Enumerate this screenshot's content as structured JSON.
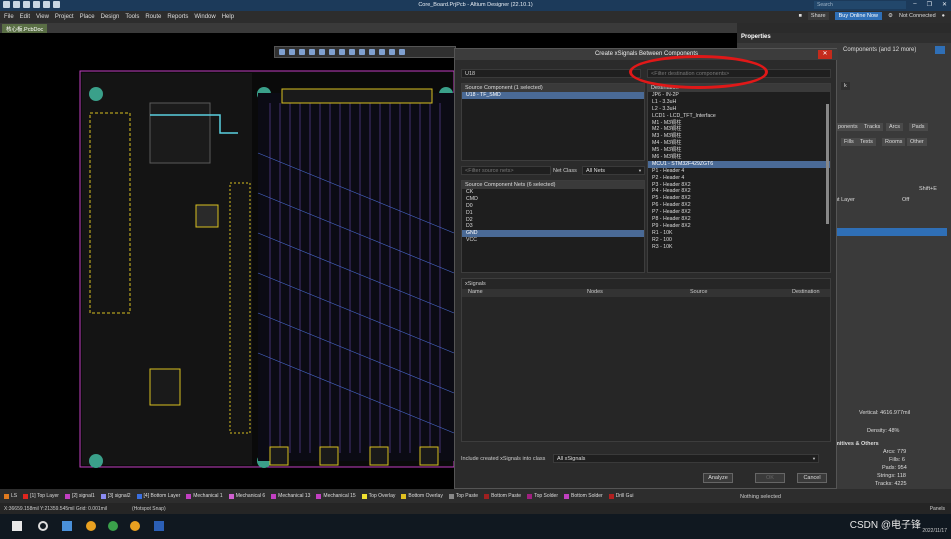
{
  "titlebar": {
    "title": "Core_Board.PrjPcb - Altium Designer (22.10.1)",
    "search": "Search"
  },
  "menu": {
    "items": [
      "File",
      "Edit",
      "View",
      "Project",
      "Place",
      "Design",
      "Tools",
      "Route",
      "Reports",
      "Window",
      "Help"
    ],
    "share": "Share",
    "buy_online": "Buy Online Now",
    "not_connected": "Not Connected"
  },
  "doc_tab": "核心板.PcbDoc",
  "properties": {
    "title": "Properties",
    "components_label": "Components (and 12 more)",
    "tab_partial": "k",
    "filter_tabs": [
      "ponents",
      "Tracks",
      "Arcs",
      "Pads"
    ],
    "filter_tabs2": [
      "Fills",
      "Texts",
      "Rooms",
      "Other"
    ],
    "shift_e": "Shift+E",
    "current_layer_label": "nt Layer",
    "current_layer_value": "Off",
    "vertical": "Vertical:  4616.977mil",
    "density": "Density:  48%",
    "prims_title": "mitives & Others",
    "stats": [
      "Arcs:  779",
      "Fills:  6",
      "Pads:  954",
      "Strings:  118",
      "Tracks:  4225"
    ],
    "panels": "Panels"
  },
  "dialog": {
    "title": "Create xSignals Between Components",
    "source_filter": "U18",
    "dest_filter_placeholder": "<Filter destination components>",
    "source_header": "Source Component (1 selected)",
    "source_items": [
      {
        "label": "U18 - TF_SMD",
        "selected": true
      }
    ],
    "dest_header": "Destination",
    "dest_items": [
      {
        "label": "JP6 - IN-2P",
        "selected": false
      },
      {
        "label": "L1 - 3.3uH",
        "selected": false
      },
      {
        "label": "L2 - 3.3uH",
        "selected": false
      },
      {
        "label": "LCD1 - LCD_TFT_Interface",
        "selected": false
      },
      {
        "label": "M1 - M3铜柱",
        "selected": false
      },
      {
        "label": "M2 - M3铜柱",
        "selected": false
      },
      {
        "label": "M3 - M3铜柱",
        "selected": false
      },
      {
        "label": "M4 - M3铜柱",
        "selected": false
      },
      {
        "label": "M5 - M3铜柱",
        "selected": false
      },
      {
        "label": "M6 - M3铜柱",
        "selected": false
      },
      {
        "label": "MCU1 - STM32F429ZGT6",
        "selected": true
      },
      {
        "label": "P1 - Header 4",
        "selected": false
      },
      {
        "label": "P2 - Header 4",
        "selected": false
      },
      {
        "label": "P3 - Header 8X2",
        "selected": false
      },
      {
        "label": "P4 - Header 8X2",
        "selected": false
      },
      {
        "label": "P5 - Header 8X2",
        "selected": false
      },
      {
        "label": "P6 - Header 8X2",
        "selected": false
      },
      {
        "label": "P7 - Header 8X2",
        "selected": false
      },
      {
        "label": "P8 - Header 8X2",
        "selected": false
      },
      {
        "label": "P9 - Header 8X2",
        "selected": false
      },
      {
        "label": "R1 - 10K",
        "selected": false
      },
      {
        "label": "R2 - 100",
        "selected": false
      },
      {
        "label": "R3 - 10K",
        "selected": false
      }
    ],
    "nets_filter_placeholder": "<Filter source nets>",
    "net_class_label": "Net Class",
    "net_class_value": "All Nets",
    "nets_header": "Source Component Nets (6 selected)",
    "nets": [
      {
        "label": "CK",
        "selected": false
      },
      {
        "label": "CMD",
        "selected": false
      },
      {
        "label": "D0",
        "selected": false
      },
      {
        "label": "D1",
        "selected": false
      },
      {
        "label": "D2",
        "selected": false
      },
      {
        "label": "D3",
        "selected": false
      },
      {
        "label": "GND",
        "selected": true
      },
      {
        "label": "VCC",
        "selected": false
      }
    ],
    "xsignals_label": "xSignals",
    "xsignals_columns": [
      "Name",
      "Nodes",
      "Source",
      "Destination"
    ],
    "include_label": "Include created xSignals into class",
    "include_value": "All xSignals",
    "buttons": {
      "analyze": "Analyze",
      "ok": "OK",
      "cancel": "Cancel"
    }
  },
  "layers": [
    {
      "name": "LS",
      "color": "#e07a1f"
    },
    {
      "name": "[1] Top Layer",
      "color": "#e0261f"
    },
    {
      "name": "[2] signal1",
      "color": "#c23fc2"
    },
    {
      "name": "[3] signal2",
      "color": "#8a8af0"
    },
    {
      "name": "[4] Bottom Layer",
      "color": "#3a6fe0"
    },
    {
      "name": "Mechanical 1",
      "color": "#c23fc2"
    },
    {
      "name": "Mechanical 6",
      "color": "#d060d0"
    },
    {
      "name": "Mechanical 13",
      "color": "#c23fc2"
    },
    {
      "name": "Mechanical 15",
      "color": "#c23fc2"
    },
    {
      "name": "Top Overlay",
      "color": "#f0e030"
    },
    {
      "name": "Bottom Overlay",
      "color": "#e0c020"
    },
    {
      "name": "Top Paste",
      "color": "#888888"
    },
    {
      "name": "Bottom Paste",
      "color": "#a02020"
    },
    {
      "name": "Top Solder",
      "color": "#a02080"
    },
    {
      "name": "Bottom Solder",
      "color": "#c040c0"
    },
    {
      "name": "Drill Gui",
      "color": "#b02020"
    }
  ],
  "status": {
    "coords": "X:36659.158mil Y:21359.545mil  Grid: 0.001mil",
    "snap": "(Hotspot Snap)",
    "nothing_selected": "Nothing selected"
  },
  "taskbar": {
    "watermark": "CSDN @电子锋",
    "clock": "2022/11/17"
  }
}
